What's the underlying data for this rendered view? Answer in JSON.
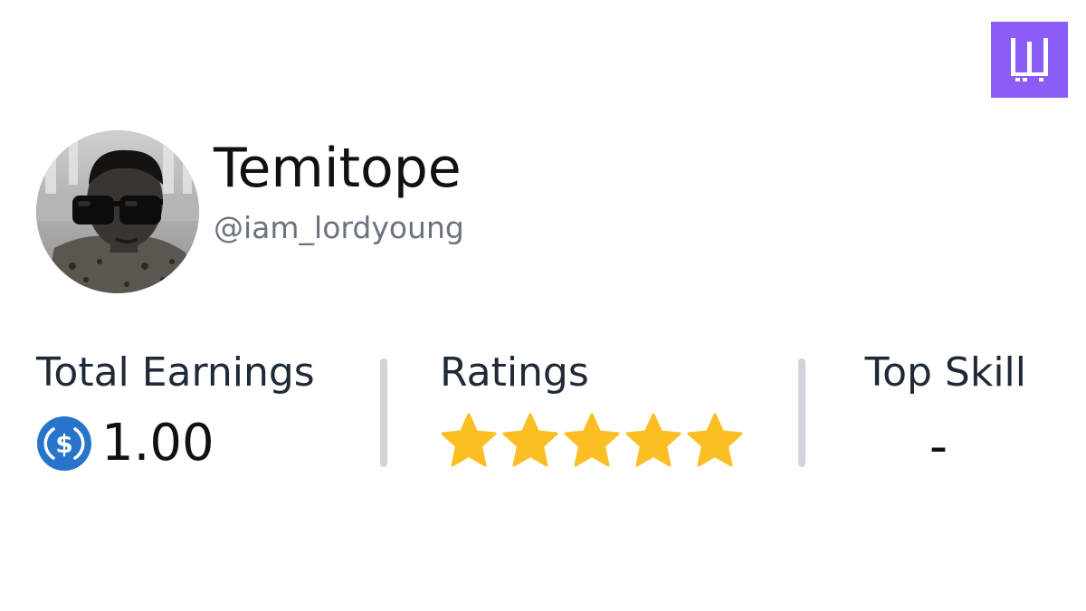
{
  "brand": {
    "logo_icon": "w-logo-icon",
    "color": "#8b5cf6"
  },
  "profile": {
    "name": "Temitope",
    "handle": "@iam_lordyoung",
    "avatar_icon": "user-avatar-photo"
  },
  "stats": {
    "earnings": {
      "label": "Total Earnings",
      "value": "1.00",
      "currency_icon": "usdc-coin-icon",
      "currency_color": "#2775ca"
    },
    "ratings": {
      "label": "Ratings",
      "stars_filled": 5,
      "stars_total": 5,
      "star_color": "#fbbf24"
    },
    "top_skill": {
      "label": "Top Skill",
      "value": "-"
    }
  }
}
